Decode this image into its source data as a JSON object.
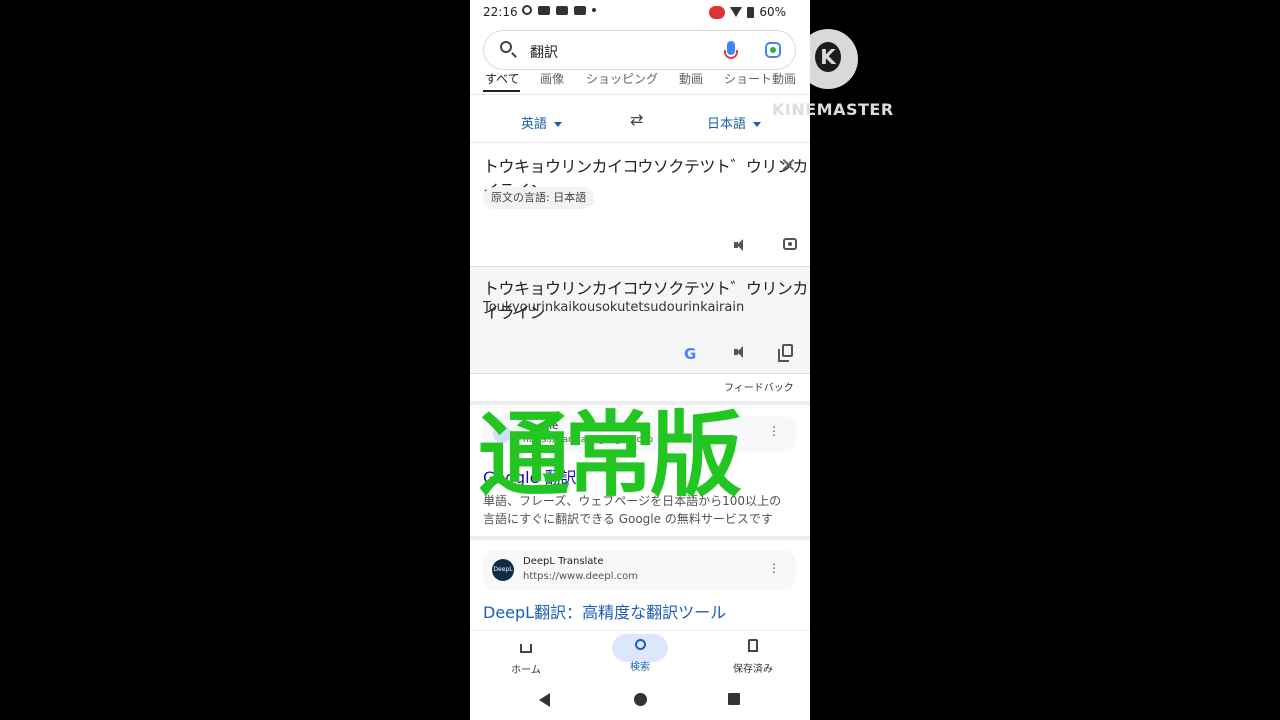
{
  "status": {
    "time": "22:16",
    "battery": "60%"
  },
  "search": {
    "query": "翻訳"
  },
  "tabs": [
    "すべて",
    "画像",
    "ショッピング",
    "動画",
    "ショート動画"
  ],
  "translate": {
    "source_lang": "英語",
    "target_lang": "日本語",
    "swap_icon": "swap-arrows-icon",
    "source_text": "トウキョウリンカイコウソクテツト゛ウリンカイライン",
    "detected_language": "原文の言語: 日本語",
    "translated_text": "トウキョウリンカイコウソクテツト゛ウリンカイライン",
    "romanization": "Toukyourinkaikousokutetsudourinkairain",
    "feedback": "フィードバック"
  },
  "results": [
    {
      "site": "Google",
      "url": "https://translate.google.co.jp",
      "title": "Google 翻訳",
      "snippet": "単語、フレーズ、ウェブページを日本語から100以上の言語にすぐに翻訳できる Google の無料サービスです"
    },
    {
      "site": "DeepL Translate",
      "url": "https://www.deepl.com",
      "title": "DeepL翻訳：高精度な翻訳ツール",
      "favicon_text": "DeepL"
    }
  ],
  "overlay_text": "通常版",
  "bottom_nav": {
    "home": "ホーム",
    "search": "検索",
    "saved": "保存済み"
  },
  "watermark": {
    "text": "KINEMASTER",
    "letter": "K"
  },
  "colors": {
    "overlay": "#22c522",
    "link": "#1a5fb4",
    "accent_pill": "#dde7fb"
  }
}
